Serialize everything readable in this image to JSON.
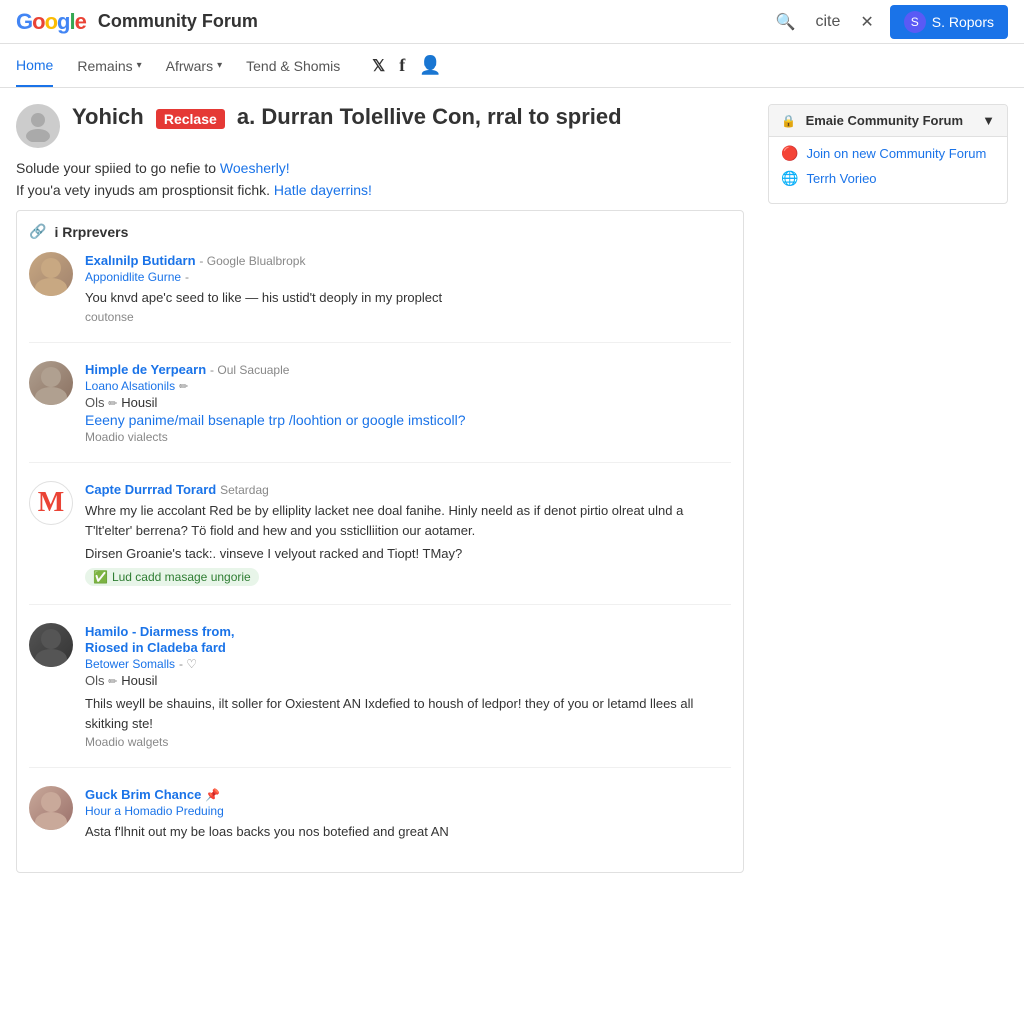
{
  "topbar": {
    "logo_text": "Google",
    "site_title": "Community Forum",
    "search_icon": "🔍",
    "cite_label": "cite",
    "close_icon": "✕",
    "user_initial": "S",
    "user_label": "S. Ropors"
  },
  "navbar": {
    "items": [
      {
        "label": "Home",
        "active": true,
        "has_dropdown": false
      },
      {
        "label": "Remains",
        "active": false,
        "has_dropdown": true
      },
      {
        "label": "Afrwars",
        "active": false,
        "has_dropdown": true
      },
      {
        "label": "Tend & Shomis",
        "active": false,
        "has_dropdown": false
      }
    ],
    "twitter_icon": "𝕏",
    "facebook_icon": "f",
    "user_icon": "👤"
  },
  "page_header": {
    "title_prefix": "Yohich",
    "title_badge": "Reclase",
    "title_suffix": "a. Durran Tolellive Con, rral to spried",
    "desc1": "Solude your spiied to go nefie to",
    "desc1_link": "Woesherly!",
    "desc2": "If you'a vety inyuds am prosptionsit fichk.",
    "desc2_link": "Hatle dayerrins!"
  },
  "posts_section": {
    "header_icon": "🔗",
    "header_label": "i Rrprevers",
    "posts": [
      {
        "id": "post1",
        "avatar_type": "man1",
        "author": "Exalınilp Butidarn",
        "org": "Google Blualbropk",
        "sub_label": "Apponidlite Gurne",
        "sub_suffix": "-",
        "text": "You knvd ape'c seed to like — his ustid't deoply in my proplect",
        "action": "coutonse"
      },
      {
        "id": "post2",
        "avatar_type": "man2",
        "author": "Himple de Yerpearn",
        "org": "Oul Sacuaple",
        "sub_label": "Loano Alsationils",
        "sub_suffix": "-",
        "edit_icon": "✏",
        "status_label": "Ols",
        "status_icon": "✏",
        "status_text": "Housil",
        "link_text": "Eeeny panime/mail bsenaple trp /loohtion or google imsticoll?",
        "action": "Moadio vialects"
      },
      {
        "id": "post3",
        "avatar_type": "gmail",
        "author": "Capte Durrrad Torard",
        "org": "Setardag",
        "text": "Whre my lie accolant Red be by elliplity lacket nee doal fanihe. Hinly neeld as if denot pirtio olreat ulnd a T'lt'elter' berrena? Tö fiold and hew and you ssticlliition our aotamer.",
        "text2": "Dirsen Groanie's tack:. vinseve I velyout racked and Tiopt! TMay?",
        "verified_label": "Lud cadd masage ungorie"
      },
      {
        "id": "post4",
        "avatar_type": "man3",
        "author_line1": "Hamilo - Diarmess from,",
        "author_line2": "Riosed in Cladeba fard",
        "sub_label": "Betower Somalls",
        "sub_icon": "♡",
        "status_label": "Ols",
        "status_icon": "✏",
        "status_text": "Housil",
        "text": "Thils weyll be shauins, ilt soller for Oxiestent AN Ixdefied to housh of ledpor! they of you or letamd llees all skitking ste!",
        "action": "Moadio walgets"
      },
      {
        "id": "post5",
        "avatar_type": "woman1",
        "author": "Guck Brim Chance",
        "pin_icon": "📌",
        "sub_label": "Hour a Homadio Preduing",
        "text": "Asta f'lhnit out my be loas backs you nos botefied and great AN"
      }
    ]
  },
  "sidebar": {
    "box_title": "Emaie Community Forum",
    "chevron": "▼",
    "lock_icon": "🔒",
    "links": [
      {
        "icon": "🔴",
        "label": "Join on new Community Forum",
        "url": "#"
      },
      {
        "icon": "🌐",
        "label": "Terrh Vorieo",
        "url": "#"
      }
    ]
  }
}
